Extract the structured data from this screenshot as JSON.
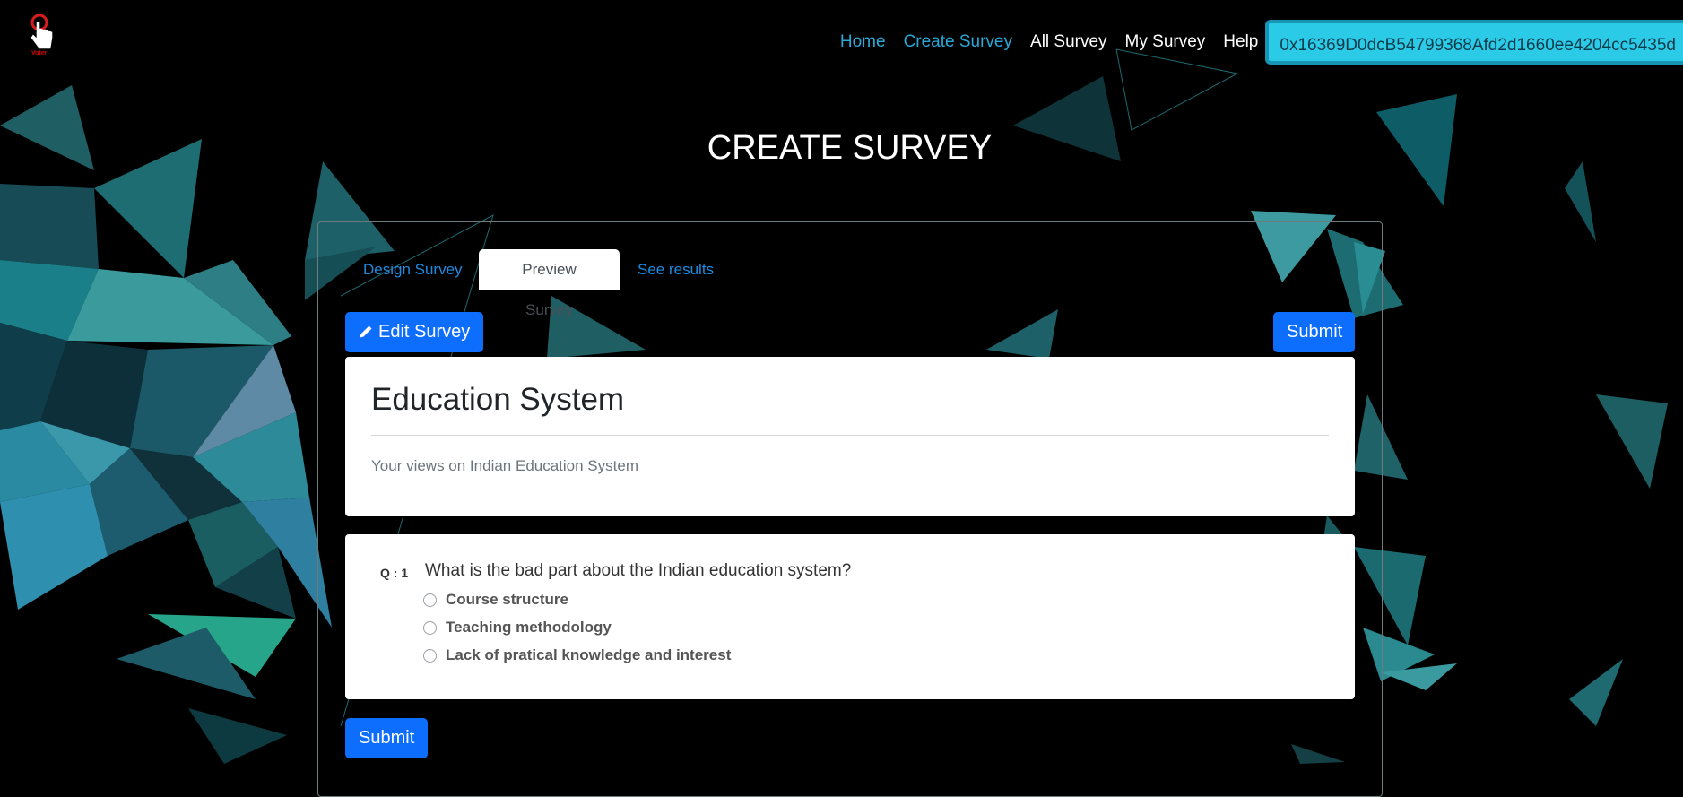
{
  "logo": {
    "icon": "hand-pointer-icon",
    "text": "Voter"
  },
  "nav": {
    "items": [
      {
        "label": "Home",
        "color": "#2aa8d6"
      },
      {
        "label": "Create Survey",
        "color": "#2aa8d6"
      },
      {
        "label": "All Survey",
        "color": "#ffffff"
      },
      {
        "label": "My Survey",
        "color": "#ffffff"
      },
      {
        "label": "Help",
        "color": "#ffffff"
      }
    ],
    "wallet_address": "0x16369D0dcB54799368Afd2d1660ee4204cc5435d"
  },
  "page_title": "CREATE SURVEY",
  "tabs": [
    {
      "label": "Design Survey",
      "active": false
    },
    {
      "label": "Preview Survey",
      "active": true
    },
    {
      "label": "See results",
      "active": false
    }
  ],
  "actions": {
    "edit_label": "Edit Survey",
    "edit_icon": "pencil-icon",
    "submit_label": "Submit"
  },
  "survey": {
    "title": "Education System",
    "description": "Your views on Indian Education System",
    "questions": [
      {
        "number": "Q : 1",
        "text": "What is the bad part about the Indian education system?",
        "options": [
          "Course structure",
          "Teaching methodology",
          "Lack of pratical knowledge and interest"
        ]
      }
    ]
  },
  "colors": {
    "primary": "#0d6efd",
    "accent": "#2bcbe8",
    "background": "#000000"
  }
}
